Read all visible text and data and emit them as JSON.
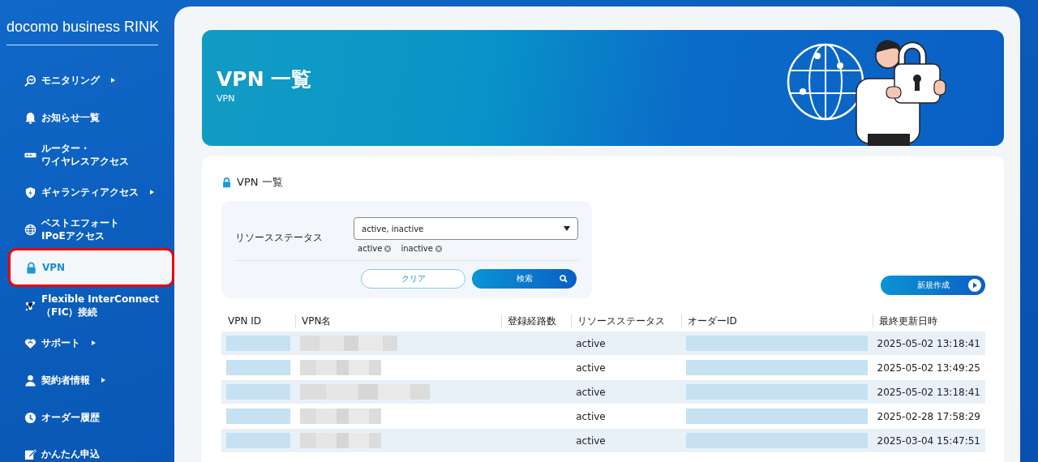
{
  "sidebar": {
    "logo": "docomo business RINK",
    "items": [
      {
        "lines": [
          "モニタリング"
        ],
        "kind": "monitor",
        "expandable": true,
        "selected": false
      },
      {
        "lines": [
          "お知らせ一覧"
        ],
        "kind": "bell",
        "expandable": false,
        "selected": false
      },
      {
        "lines": [
          "ルーター・",
          "ワイヤレスアクセス"
        ],
        "kind": "router",
        "expandable": false,
        "selected": false
      },
      {
        "lines": [
          "ギャランティアクセス"
        ],
        "kind": "shield",
        "expandable": true,
        "selected": false
      },
      {
        "lines": [
          "ベストエフォート",
          "IPoEアクセス"
        ],
        "kind": "globe",
        "expandable": false,
        "selected": false
      },
      {
        "lines": [
          "VPN"
        ],
        "kind": "lock",
        "expandable": false,
        "selected": true
      },
      {
        "lines": [
          "Flexible InterConnect",
          "（FIC）接続"
        ],
        "kind": "network",
        "expandable": false,
        "selected": false
      },
      {
        "lines": [
          "サポート"
        ],
        "kind": "support",
        "expandable": true,
        "selected": false
      },
      {
        "lines": [
          "契約者情報"
        ],
        "kind": "person",
        "expandable": true,
        "selected": false
      },
      {
        "lines": [
          "オーダー履歴"
        ],
        "kind": "clock",
        "expandable": false,
        "selected": false
      },
      {
        "lines": [
          "かんたん申込"
        ],
        "kind": "edit",
        "expandable": false,
        "selected": false
      }
    ]
  },
  "header": {
    "title": "VPN 一覧",
    "subtitle": "VPN"
  },
  "card": {
    "title": "VPN 一覧",
    "filter": {
      "label": "リソースステータス",
      "value": "active, inactive",
      "chips": [
        "active",
        "inactive"
      ],
      "buttons": [
        {
          "label": "クリア",
          "kind": "outline"
        },
        {
          "label": "検索",
          "kind": "search"
        }
      ]
    },
    "create_button": "新規作成"
  },
  "table": {
    "columns": [
      {
        "label": "VPN ID",
        "kind": "redacted_id"
      },
      {
        "label": "VPN名",
        "kind": "redacted_name"
      },
      {
        "label": "登録経路数",
        "kind": "blank"
      },
      {
        "label": "リソースステータス",
        "kind": "status"
      },
      {
        "label": "オーダーID",
        "kind": "redacted_id"
      },
      {
        "label": "最終更新日時",
        "kind": "updated"
      }
    ],
    "rows": [
      {
        "status": "active",
        "updated": "2025-05-02 13:18:41"
      },
      {
        "status": "active",
        "updated": "2025-05-02 13:49:25"
      },
      {
        "status": "active",
        "updated": "2025-05-02 13:18:41"
      },
      {
        "status": "active",
        "updated": "2025-02-28 17:58:29"
      },
      {
        "status": "active",
        "updated": "2025-03-04 15:47:51"
      }
    ]
  }
}
